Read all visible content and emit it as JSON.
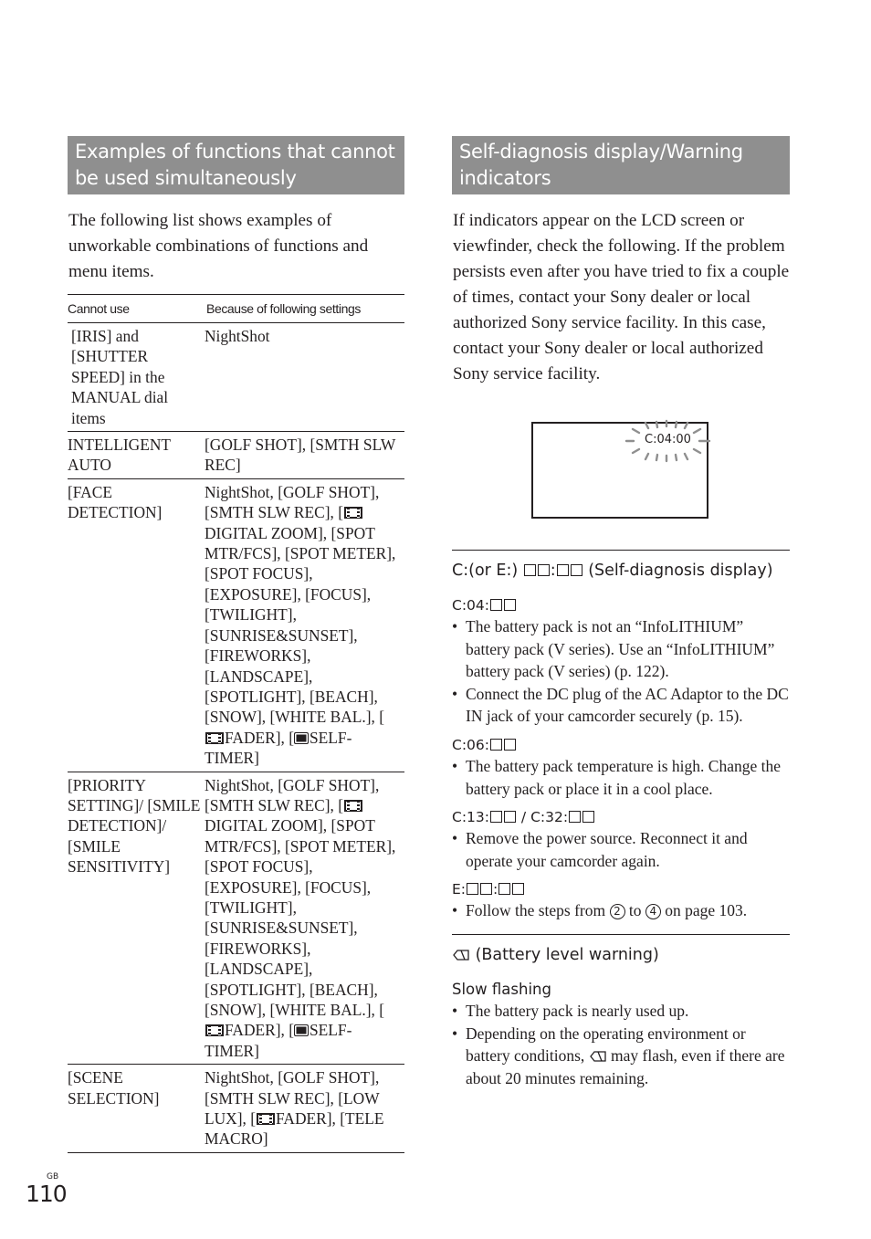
{
  "left": {
    "title": "Examples of functions that cannot be used simultaneously",
    "intro": "The following list shows examples of unworkable combinations of functions and menu items.",
    "table": {
      "headers": [
        "Cannot use",
        "Because of following settings"
      ],
      "rows": [
        {
          "cannot_use": "[IRIS] and [SHUTTER SPEED] in the MANUAL dial items",
          "because": [
            {
              "t": "NightShot"
            }
          ]
        },
        {
          "cannot_use": "INTELLIGENT AUTO",
          "because": [
            {
              "t": "[GOLF SHOT], [SMTH SLW REC]"
            }
          ]
        },
        {
          "cannot_use": "[FACE DETECTION]",
          "because": [
            {
              "t": "NightShot, [GOLF SHOT], [SMTH SLW REC], ["
            },
            {
              "icon": "film-icon"
            },
            {
              "t": "DIGITAL ZOOM], [SPOT MTR/FCS], [SPOT METER], [SPOT FOCUS], [EXPOSURE], [FOCUS], [TWILIGHT], [SUNRISE&SUNSET], [FIREWORKS], [LANDSCAPE], [SPOTLIGHT], [BEACH], [SNOW], [WHITE BAL.], ["
            },
            {
              "icon": "film-icon"
            },
            {
              "t": "FADER], ["
            },
            {
              "icon": "self-timer-icon"
            },
            {
              "t": "SELF-TIMER]"
            }
          ]
        },
        {
          "cannot_use": "[PRIORITY SETTING]/ [SMILE DETECTION]/ [SMILE SENSITIVITY]",
          "because": [
            {
              "t": "NightShot, [GOLF SHOT], [SMTH SLW REC], ["
            },
            {
              "icon": "film-icon"
            },
            {
              "t": "DIGITAL ZOOM], [SPOT MTR/FCS], [SPOT METER], [SPOT FOCUS], [EXPOSURE], [FOCUS], [TWILIGHT], [SUNRISE&SUNSET], [FIREWORKS], [LANDSCAPE], [SPOTLIGHT], [BEACH], [SNOW], [WHITE BAL.], ["
            },
            {
              "icon": "film-icon"
            },
            {
              "t": "FADER], ["
            },
            {
              "icon": "self-timer-icon"
            },
            {
              "t": "SELF-TIMER]"
            }
          ]
        },
        {
          "cannot_use": "[SCENE SELECTION]",
          "because": [
            {
              "t": "NightShot, [GOLF SHOT], [SMTH SLW REC], [LOW LUX], ["
            },
            {
              "icon": "film-icon"
            },
            {
              "t": "FADER], [TELE MACRO]"
            }
          ]
        }
      ]
    }
  },
  "right": {
    "title": "Self-diagnosis display/Warning indicators",
    "intro": "If indicators appear on the LCD screen or viewfinder, check the following. If the problem persists even after you have tried to fix a couple of times, contact your Sony dealer or local authorized Sony service facility. In this case, contact your Sony dealer or local authorized Sony service facility.",
    "lcd_code": "C:04:00",
    "self_diag": {
      "heading_prefix": "C:(or E:) ",
      "heading_suffix": " (Self-diagnosis display)",
      "codes": [
        {
          "label_prefix": "C:04:",
          "bullets": [
            "The battery pack is not an “InfoLITHIUM” battery pack (V series). Use an “InfoLITHIUM” battery pack (V series) (p. 122).",
            "Connect the DC plug of the AC Adaptor to the DC IN jack of your camcorder securely (p. 15)."
          ]
        },
        {
          "label_prefix": "C:06:",
          "bullets": [
            "The battery pack temperature is high. Change the battery pack or place it in a cool place."
          ]
        },
        {
          "label_a": "C:13:",
          "label_sep": " / C:32:",
          "bullets": [
            "Remove the power source. Reconnect it and operate your camcorder again."
          ]
        },
        {
          "label_prefix": "E:",
          "bullets_parts": {
            "before": "Follow the steps from ",
            "step_a": "2",
            "mid": " to ",
            "step_b": "4",
            "after": " on page 103."
          }
        }
      ]
    },
    "battery": {
      "heading": "(Battery level warning)",
      "subheading": "Slow flashing",
      "bullet1": "The battery pack is nearly used up.",
      "bullet2_before": "Depending on the operating environment or battery conditions, ",
      "bullet2_after": " may flash, even if there are about 20 minutes remaining."
    }
  },
  "footer": {
    "region": "GB",
    "page_number": "110"
  }
}
